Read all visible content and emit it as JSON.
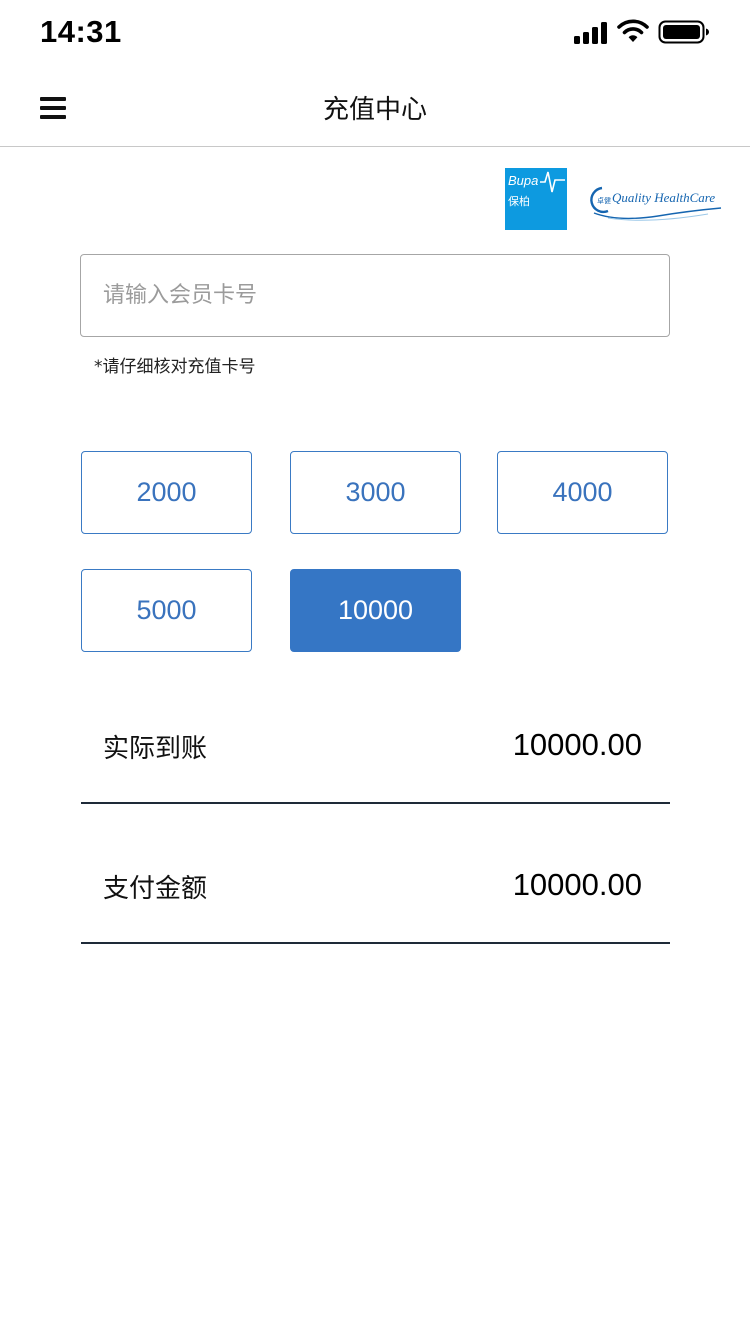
{
  "status_bar": {
    "time": "14:31"
  },
  "header": {
    "title": "充值中心",
    "menu_icon": "hamburger-menu-icon"
  },
  "logos": {
    "bupa_en": "Bupa",
    "bupa_cn": "保柏",
    "qhc_text": "Quality HealthCare",
    "qhc_cn": "卓健"
  },
  "card_input": {
    "value": "",
    "placeholder": "请输入会员卡号"
  },
  "hint": "*请仔细核对充值卡号",
  "amounts": {
    "options": [
      "2000",
      "3000",
      "4000",
      "5000",
      "10000"
    ],
    "selected": "10000"
  },
  "summary": {
    "actual_label": "实际到账",
    "actual_value": "10000.00",
    "pay_label": "支付金额",
    "pay_value": "10000.00"
  },
  "colors": {
    "accent": "#3576c5",
    "bupa_blue": "#0d9ae0",
    "divider": "#1e2a38"
  }
}
